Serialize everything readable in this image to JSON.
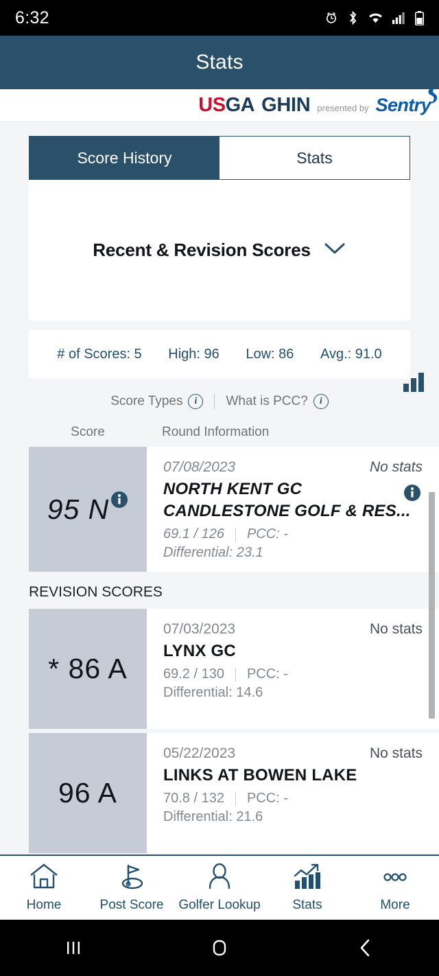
{
  "statusbar": {
    "time": "6:32",
    "icons": [
      "alarm-icon",
      "bluetooth-icon",
      "wifi-icon",
      "cellular-signal-icon",
      "battery-icon"
    ]
  },
  "titlebar": {
    "title": "Stats"
  },
  "brand": {
    "usga_us": "US",
    "usga_ga": "GA",
    "ghin": "GHIN",
    "presented_by": "presented by",
    "sentry": "Sentry"
  },
  "tabs": [
    {
      "label": "Score History",
      "active": true
    },
    {
      "label": "Stats",
      "active": false
    }
  ],
  "section": {
    "title": "Recent & Revision Scores",
    "chevron": "chevron-down-icon"
  },
  "summary": [
    "# of Scores: 5",
    "High: 96",
    "Low: 86",
    "Avg.: 91.0"
  ],
  "summary_values": {
    "num_scores": "5",
    "high": "96",
    "low": "86",
    "avg": "91.0"
  },
  "infolinks": {
    "score_types": "Score Types",
    "what_is_pcc": "What is PCC?"
  },
  "columns": {
    "score": "Score",
    "round_information": "Round Information"
  },
  "group_label": "REVISION SCORES",
  "rows": [
    {
      "score": "95 N",
      "has_score_info": true,
      "pending": true,
      "date": "07/08/2023",
      "stats": "No stats",
      "course": "NORTH KENT GC",
      "course2": "CANDLESTONE GOLF & RES...",
      "rating_slope": "69.1 / 126",
      "pcc": "PCC: -",
      "differential": "Differential: 23.1",
      "has_row_info": true
    },
    {
      "score": "* 86 A",
      "has_score_info": false,
      "pending": false,
      "date": "07/03/2023",
      "stats": "No stats",
      "course": "LYNX GC",
      "course2": "",
      "rating_slope": "69.2 / 130",
      "pcc": "PCC: -",
      "differential": "Differential: 14.6",
      "has_row_info": false
    },
    {
      "score": "96 A",
      "has_score_info": false,
      "pending": false,
      "date": "05/22/2023",
      "stats": "No stats",
      "course": "LINKS AT BOWEN LAKE",
      "course2": "",
      "rating_slope": "70.8 / 132",
      "pcc": "PCC: -",
      "differential": "Differential: 21.6",
      "has_row_info": false
    }
  ],
  "bottomnav": [
    {
      "label": "Home",
      "icon": "home-icon"
    },
    {
      "label": "Post Score",
      "icon": "golf-flag-icon"
    },
    {
      "label": "Golfer Lookup",
      "icon": "person-icon"
    },
    {
      "label": "Stats",
      "icon": "bar-chart-icon"
    },
    {
      "label": "More",
      "icon": "ellipsis-icon"
    }
  ],
  "androidnav": [
    "recents-button",
    "home-button",
    "back-button"
  ],
  "colors": {
    "navy": "#2b5069",
    "score_box": "#c5ccd6",
    "page_bg": "#f4f5f6",
    "usga_red": "#c8102e",
    "sentry_blue": "#0b5ca8"
  }
}
